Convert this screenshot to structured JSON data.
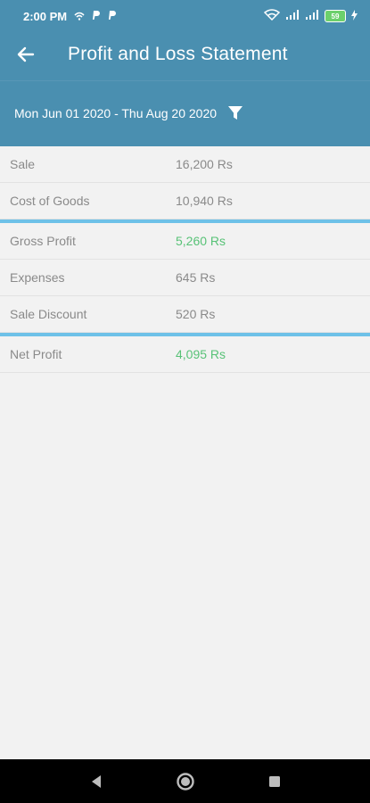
{
  "status_bar": {
    "time": "2:00 PM",
    "battery": "59"
  },
  "toolbar": {
    "title": "Profit and Loss Statement"
  },
  "date_range": "Mon Jun 01 2020 - Thu Aug 20 2020",
  "rows_group1": [
    {
      "label": "Sale",
      "value": "16,200 Rs"
    },
    {
      "label": "Cost of Goods",
      "value": "10,940 Rs"
    }
  ],
  "rows_group2": [
    {
      "label": "Gross Profit",
      "value": "5,260 Rs"
    },
    {
      "label": "Expenses",
      "value": "645 Rs"
    },
    {
      "label": "Sale Discount",
      "value": "520 Rs"
    }
  ],
  "rows_group3": [
    {
      "label": "Net Profit",
      "value": "4,095 Rs"
    }
  ],
  "colors": {
    "appbar": "#4a8fb0",
    "separator": "#6ec1e8",
    "positive": "#58c277"
  }
}
